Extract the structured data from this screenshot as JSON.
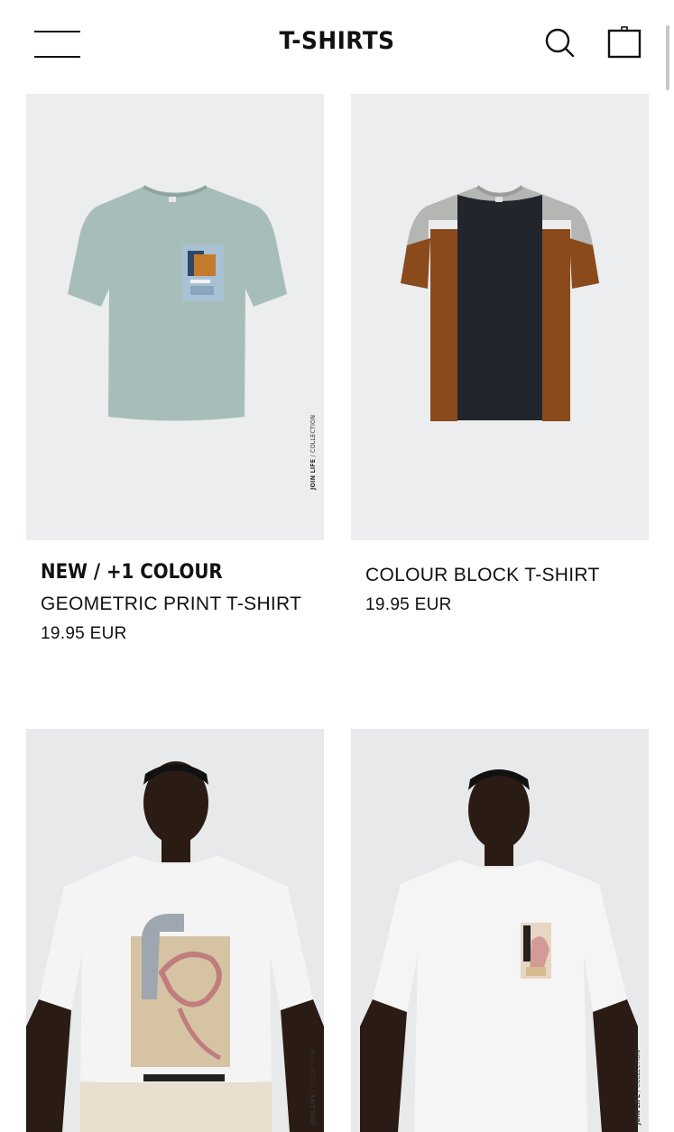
{
  "header": {
    "title": "T-SHIRTS",
    "icons": [
      "menu-icon",
      "search-icon",
      "shopping-bag-icon"
    ]
  },
  "colors": {
    "text": "#111111",
    "image_background": "#ebedee"
  },
  "products": [
    {
      "tag": "NEW / +1 COLOUR",
      "name": "GEOMETRIC PRINT T-SHIRT",
      "price": "19.95 EUR",
      "badge_bold": "JOIN LIFE",
      "badge_rest": " / COLLECTION"
    },
    {
      "tag": "",
      "name": "COLOUR BLOCK T-SHIRT",
      "price": "19.95 EUR"
    },
    {
      "badge_bold": "JOIN LIFE",
      "badge_rest": " / COLLECTION"
    },
    {
      "badge_bold": "JOIN LIFE",
      "badge_rest": " / COLLECTION"
    }
  ]
}
